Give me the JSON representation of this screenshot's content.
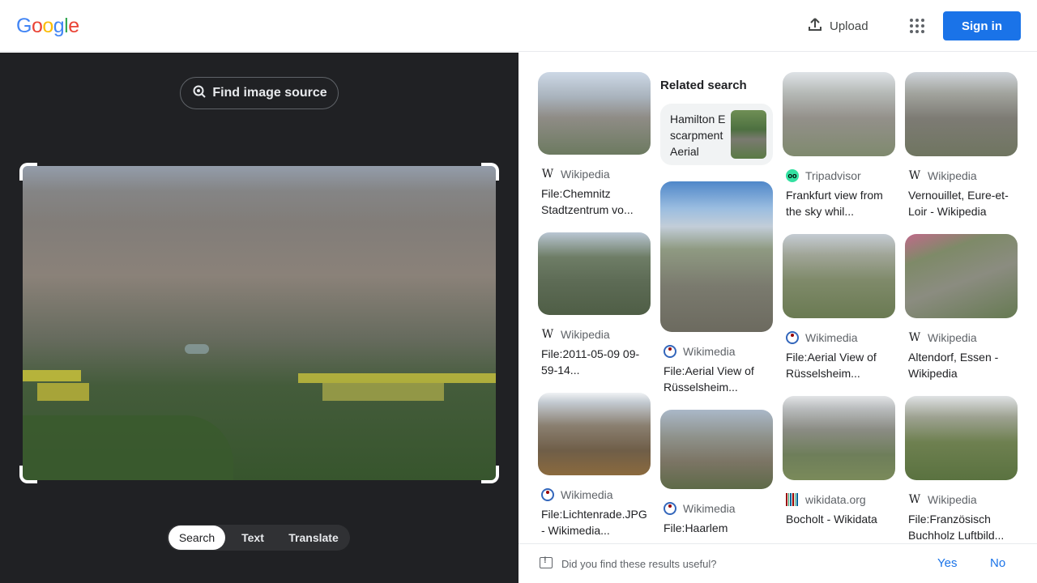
{
  "header": {
    "logo_letters": [
      {
        "ch": "G",
        "color": "#4285F4"
      },
      {
        "ch": "o",
        "color": "#EA4335"
      },
      {
        "ch": "o",
        "color": "#FBBC05"
      },
      {
        "ch": "g",
        "color": "#4285F4"
      },
      {
        "ch": "l",
        "color": "#34A853"
      },
      {
        "ch": "e",
        "color": "#EA4335"
      }
    ],
    "upload_label": "Upload",
    "signin_label": "Sign in",
    "accent_color": "#1a73e8"
  },
  "left_panel": {
    "find_source_label": "Find image source",
    "modes": [
      {
        "label": "Search",
        "active": true
      },
      {
        "label": "Text",
        "active": false
      },
      {
        "label": "Translate",
        "active": false
      }
    ]
  },
  "related": {
    "heading": "Related search",
    "chip_text": "Hamilton Escarpment Aerial"
  },
  "results": {
    "col1": [
      {
        "source": "Wikipedia",
        "icon": "wikipedia-icon",
        "title": "File:Chemnitz Stadtzentrum vo..."
      },
      {
        "source": "Wikipedia",
        "icon": "wikipedia-icon",
        "title": "File:2011-05-09 09-59-14..."
      },
      {
        "source": "Wikimedia",
        "icon": "wikimedia-icon",
        "title": "File:Lichtenrade.JPG - Wikimedia..."
      }
    ],
    "col2": [
      {
        "source": "Wikimedia",
        "icon": "wikimedia-icon",
        "title": "File:Aerial View of Rüsselsheim..."
      },
      {
        "source": "Wikimedia",
        "icon": "wikimedia-icon",
        "title": "File:Haarlem"
      }
    ],
    "col3": [
      {
        "source": "Tripadvisor",
        "icon": "tripadvisor-icon",
        "title": "Frankfurt view from the sky whil..."
      },
      {
        "source": "Wikimedia",
        "icon": "wikimedia-icon",
        "title": "File:Aerial View of Rüsselsheim..."
      },
      {
        "source": "wikidata.org",
        "icon": "wikidata-icon",
        "title": "Bocholt - Wikidata"
      }
    ],
    "col4": [
      {
        "source": "Wikipedia",
        "icon": "wikipedia-icon",
        "title": "Vernouillet, Eure-et-Loir - Wikipedia"
      },
      {
        "source": "Wikipedia",
        "icon": "wikipedia-icon",
        "title": "Altendorf, Essen - Wikipedia"
      },
      {
        "source": "Wikipedia",
        "icon": "wikipedia-icon",
        "title": "File:Französisch Buchholz Luftbild..."
      }
    ]
  },
  "feedback": {
    "question": "Did you find these results useful?",
    "yes": "Yes",
    "no": "No"
  }
}
